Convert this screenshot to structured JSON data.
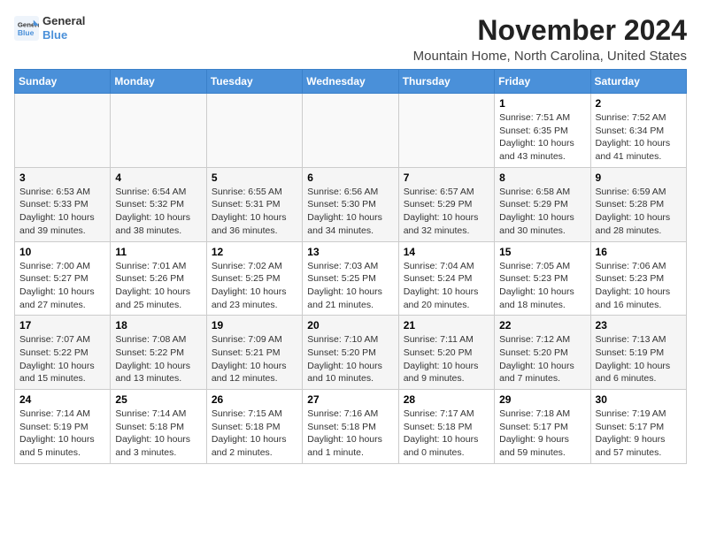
{
  "app": {
    "logo_line1": "General",
    "logo_line2": "Blue"
  },
  "header": {
    "month": "November 2024",
    "location": "Mountain Home, North Carolina, United States"
  },
  "weekdays": [
    "Sunday",
    "Monday",
    "Tuesday",
    "Wednesday",
    "Thursday",
    "Friday",
    "Saturday"
  ],
  "rows": [
    {
      "cells": [
        {
          "day": "",
          "info": ""
        },
        {
          "day": "",
          "info": ""
        },
        {
          "day": "",
          "info": ""
        },
        {
          "day": "",
          "info": ""
        },
        {
          "day": "",
          "info": ""
        },
        {
          "day": "1",
          "info": "Sunrise: 7:51 AM\nSunset: 6:35 PM\nDaylight: 10 hours and 43 minutes."
        },
        {
          "day": "2",
          "info": "Sunrise: 7:52 AM\nSunset: 6:34 PM\nDaylight: 10 hours and 41 minutes."
        }
      ]
    },
    {
      "cells": [
        {
          "day": "3",
          "info": "Sunrise: 6:53 AM\nSunset: 5:33 PM\nDaylight: 10 hours and 39 minutes."
        },
        {
          "day": "4",
          "info": "Sunrise: 6:54 AM\nSunset: 5:32 PM\nDaylight: 10 hours and 38 minutes."
        },
        {
          "day": "5",
          "info": "Sunrise: 6:55 AM\nSunset: 5:31 PM\nDaylight: 10 hours and 36 minutes."
        },
        {
          "day": "6",
          "info": "Sunrise: 6:56 AM\nSunset: 5:30 PM\nDaylight: 10 hours and 34 minutes."
        },
        {
          "day": "7",
          "info": "Sunrise: 6:57 AM\nSunset: 5:29 PM\nDaylight: 10 hours and 32 minutes."
        },
        {
          "day": "8",
          "info": "Sunrise: 6:58 AM\nSunset: 5:29 PM\nDaylight: 10 hours and 30 minutes."
        },
        {
          "day": "9",
          "info": "Sunrise: 6:59 AM\nSunset: 5:28 PM\nDaylight: 10 hours and 28 minutes."
        }
      ]
    },
    {
      "cells": [
        {
          "day": "10",
          "info": "Sunrise: 7:00 AM\nSunset: 5:27 PM\nDaylight: 10 hours and 27 minutes."
        },
        {
          "day": "11",
          "info": "Sunrise: 7:01 AM\nSunset: 5:26 PM\nDaylight: 10 hours and 25 minutes."
        },
        {
          "day": "12",
          "info": "Sunrise: 7:02 AM\nSunset: 5:25 PM\nDaylight: 10 hours and 23 minutes."
        },
        {
          "day": "13",
          "info": "Sunrise: 7:03 AM\nSunset: 5:25 PM\nDaylight: 10 hours and 21 minutes."
        },
        {
          "day": "14",
          "info": "Sunrise: 7:04 AM\nSunset: 5:24 PM\nDaylight: 10 hours and 20 minutes."
        },
        {
          "day": "15",
          "info": "Sunrise: 7:05 AM\nSunset: 5:23 PM\nDaylight: 10 hours and 18 minutes."
        },
        {
          "day": "16",
          "info": "Sunrise: 7:06 AM\nSunset: 5:23 PM\nDaylight: 10 hours and 16 minutes."
        }
      ]
    },
    {
      "cells": [
        {
          "day": "17",
          "info": "Sunrise: 7:07 AM\nSunset: 5:22 PM\nDaylight: 10 hours and 15 minutes."
        },
        {
          "day": "18",
          "info": "Sunrise: 7:08 AM\nSunset: 5:22 PM\nDaylight: 10 hours and 13 minutes."
        },
        {
          "day": "19",
          "info": "Sunrise: 7:09 AM\nSunset: 5:21 PM\nDaylight: 10 hours and 12 minutes."
        },
        {
          "day": "20",
          "info": "Sunrise: 7:10 AM\nSunset: 5:20 PM\nDaylight: 10 hours and 10 minutes."
        },
        {
          "day": "21",
          "info": "Sunrise: 7:11 AM\nSunset: 5:20 PM\nDaylight: 10 hours and 9 minutes."
        },
        {
          "day": "22",
          "info": "Sunrise: 7:12 AM\nSunset: 5:20 PM\nDaylight: 10 hours and 7 minutes."
        },
        {
          "day": "23",
          "info": "Sunrise: 7:13 AM\nSunset: 5:19 PM\nDaylight: 10 hours and 6 minutes."
        }
      ]
    },
    {
      "cells": [
        {
          "day": "24",
          "info": "Sunrise: 7:14 AM\nSunset: 5:19 PM\nDaylight: 10 hours and 5 minutes."
        },
        {
          "day": "25",
          "info": "Sunrise: 7:14 AM\nSunset: 5:18 PM\nDaylight: 10 hours and 3 minutes."
        },
        {
          "day": "26",
          "info": "Sunrise: 7:15 AM\nSunset: 5:18 PM\nDaylight: 10 hours and 2 minutes."
        },
        {
          "day": "27",
          "info": "Sunrise: 7:16 AM\nSunset: 5:18 PM\nDaylight: 10 hours and 1 minute."
        },
        {
          "day": "28",
          "info": "Sunrise: 7:17 AM\nSunset: 5:18 PM\nDaylight: 10 hours and 0 minutes."
        },
        {
          "day": "29",
          "info": "Sunrise: 7:18 AM\nSunset: 5:17 PM\nDaylight: 9 hours and 59 minutes."
        },
        {
          "day": "30",
          "info": "Sunrise: 7:19 AM\nSunset: 5:17 PM\nDaylight: 9 hours and 57 minutes."
        }
      ]
    }
  ]
}
